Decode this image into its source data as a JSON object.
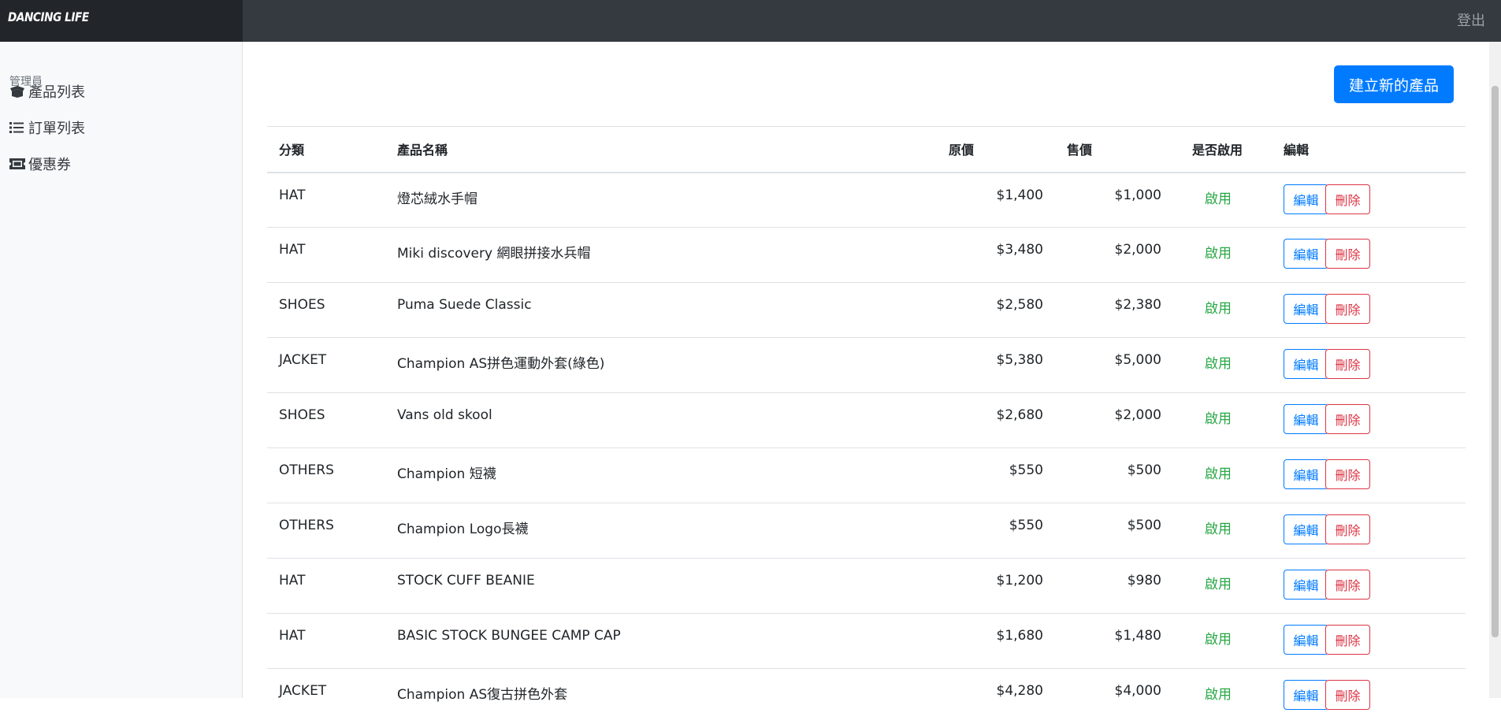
{
  "header": {
    "brand": "DANCING LIFE",
    "logout": "登出"
  },
  "sidebar": {
    "heading": "管理員",
    "items": [
      {
        "label": "產品列表",
        "icon": "box-open-icon"
      },
      {
        "label": "訂單列表",
        "icon": "list-icon"
      },
      {
        "label": "優惠券",
        "icon": "ticket-icon"
      }
    ]
  },
  "main": {
    "new_button": "建立新的產品",
    "columns": [
      "分類",
      "產品名稱",
      "原價",
      "售價",
      "是否啟用",
      "編輯"
    ],
    "edit_label": "編輯",
    "delete_label": "刪除",
    "rows": [
      {
        "category": "HAT",
        "name": "燈芯絨水手帽",
        "origin_price": "$1,400",
        "price": "$1,000",
        "status": "啟用"
      },
      {
        "category": "HAT",
        "name": "Miki discovery 網眼拼接水兵帽",
        "origin_price": "$3,480",
        "price": "$2,000",
        "status": "啟用"
      },
      {
        "category": "SHOES",
        "name": "Puma Suede Classic",
        "origin_price": "$2,580",
        "price": "$2,380",
        "status": "啟用"
      },
      {
        "category": "JACKET",
        "name": "Champion AS拼色運動外套(綠色)",
        "origin_price": "$5,380",
        "price": "$5,000",
        "status": "啟用"
      },
      {
        "category": "SHOES",
        "name": "Vans old skool",
        "origin_price": "$2,680",
        "price": "$2,000",
        "status": "啟用"
      },
      {
        "category": "OTHERS",
        "name": "Champion 短襪",
        "origin_price": "$550",
        "price": "$500",
        "status": "啟用"
      },
      {
        "category": "OTHERS",
        "name": "Champion Logo長襪",
        "origin_price": "$550",
        "price": "$500",
        "status": "啟用"
      },
      {
        "category": "HAT",
        "name": "STOCK CUFF BEANIE",
        "origin_price": "$1,200",
        "price": "$980",
        "status": "啟用"
      },
      {
        "category": "HAT",
        "name": "BASIC STOCK BUNGEE CAMP CAP",
        "origin_price": "$1,680",
        "price": "$1,480",
        "status": "啟用"
      },
      {
        "category": "JACKET",
        "name": "Champion AS復古拼色外套",
        "origin_price": "$4,280",
        "price": "$4,000",
        "status": "啟用"
      }
    ]
  },
  "colors": {
    "primary": "#007bff",
    "danger": "#dc3545",
    "success": "#28a745",
    "navbar": "#343a40"
  }
}
